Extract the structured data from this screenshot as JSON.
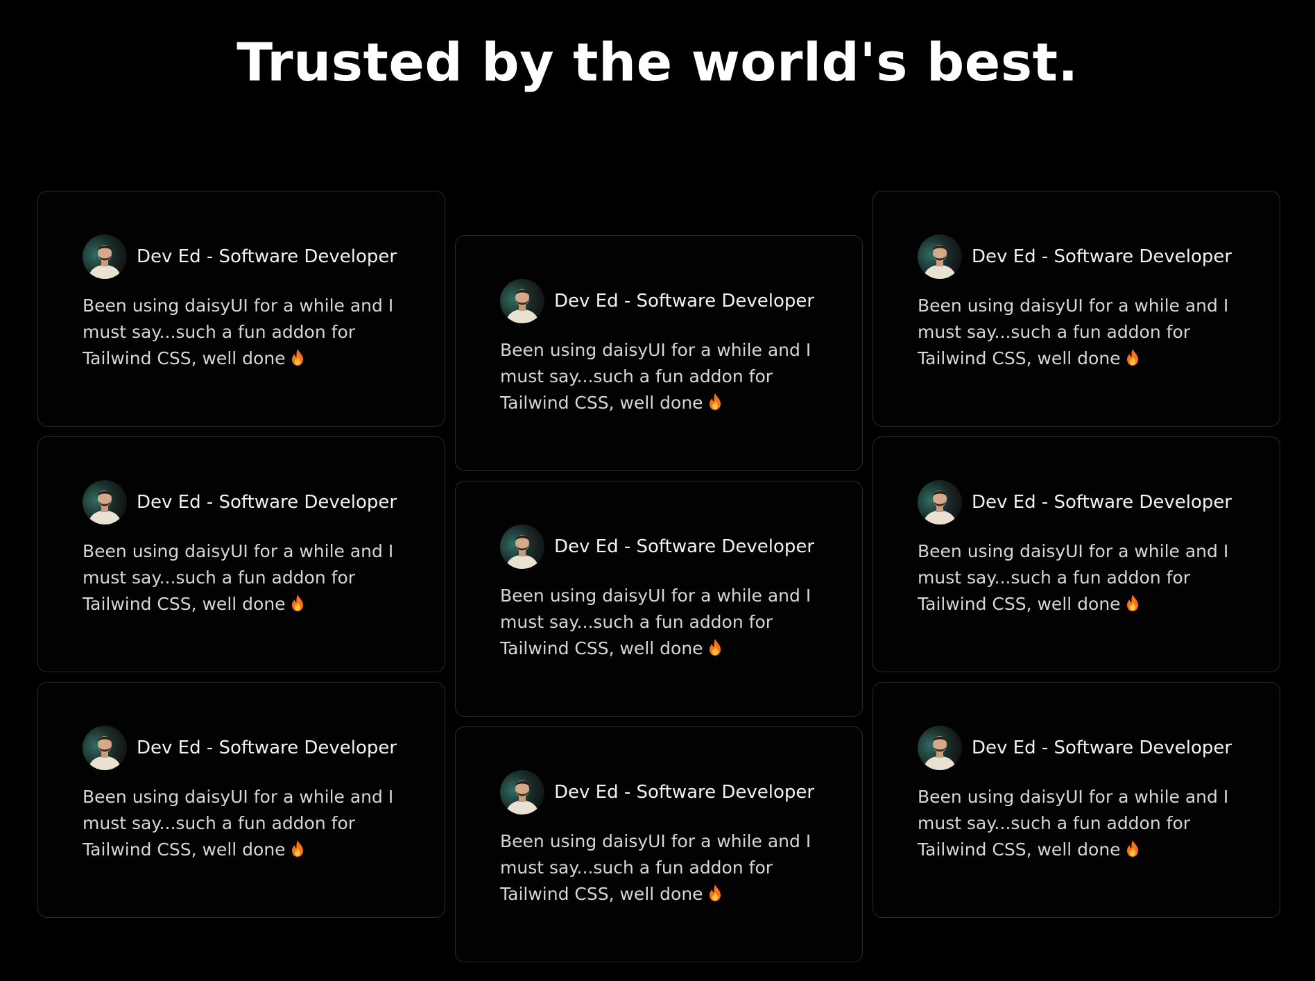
{
  "page": {
    "title": "Trusted by the world's best."
  },
  "colors": {
    "background": "#000000",
    "card_border": "#2a2a2e",
    "text": "#ffffff",
    "muted_text": "#d6d6d6",
    "fire": "#f7731c"
  },
  "testimonials": {
    "columns": [
      {
        "cards": [
          {
            "author": "Dev Ed - Software Developer",
            "quote": "Been using daisyUI for a while and I must say...such a fun addon for Tailwind CSS, well done",
            "emoji_icon": "fire-icon"
          },
          {
            "author": "Dev Ed - Software Developer",
            "quote": "Been using daisyUI for a while and I must say...such a fun addon for Tailwind CSS, well done",
            "emoji_icon": "fire-icon"
          },
          {
            "author": "Dev Ed - Software Developer",
            "quote": "Been using daisyUI for a while and I must say...such a fun addon for Tailwind CSS, well done",
            "emoji_icon": "fire-icon"
          }
        ]
      },
      {
        "cards": [
          {
            "author": "Dev Ed - Software Developer",
            "quote": "Been using daisyUI for a while and I must say...such a fun addon for Tailwind CSS, well done",
            "emoji_icon": "fire-icon"
          },
          {
            "author": "Dev Ed - Software Developer",
            "quote": "Been using daisyUI for a while and I must say...such a fun addon for Tailwind CSS, well done",
            "emoji_icon": "fire-icon"
          },
          {
            "author": "Dev Ed - Software Developer",
            "quote": "Been using daisyUI for a while and I must say...such a fun addon for Tailwind CSS, well done",
            "emoji_icon": "fire-icon"
          }
        ]
      },
      {
        "cards": [
          {
            "author": "Dev Ed - Software Developer",
            "quote": "Been using daisyUI for a while and I must say...such a fun addon for Tailwind CSS, well done",
            "emoji_icon": "fire-icon"
          },
          {
            "author": "Dev Ed - Software Developer",
            "quote": "Been using daisyUI for a while and I must say...such a fun addon for Tailwind CSS, well done",
            "emoji_icon": "fire-icon"
          },
          {
            "author": "Dev Ed - Software Developer",
            "quote": "Been using daisyUI for a while and I must say...such a fun addon for Tailwind CSS, well done",
            "emoji_icon": "fire-icon"
          }
        ]
      }
    ]
  }
}
